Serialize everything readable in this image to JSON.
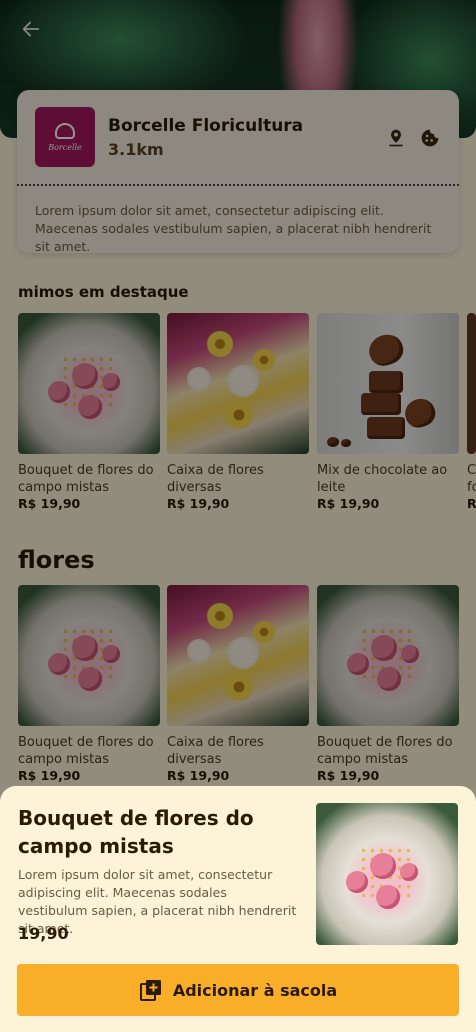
{
  "store": {
    "name": "Borcelle Floricultura",
    "distance": "3.1km",
    "logo_text": "Borcelle",
    "description": "Lorem ipsum dolor sit amet, consectetur adipiscing elit. Maecenas sodales vestibulum sapien, a placerat nibh hendrerit sit amet."
  },
  "sections": {
    "featured_title": "mimos em destaque",
    "flowers_title": "flores"
  },
  "featured": [
    {
      "name": "Bouquet de flores do campo mistas",
      "price": "R$ 19,90",
      "image": "bouquet"
    },
    {
      "name": "Caixa de flores diversas",
      "price": "R$ 19,90",
      "image": "flower-box"
    },
    {
      "name": "Mix de chocolate ao leite",
      "price": "R$ 19,90",
      "image": "chocolate"
    },
    {
      "name": "C fo",
      "price": "R",
      "image": "partial"
    }
  ],
  "flowers": [
    {
      "name": "Bouquet de flores do campo mistas",
      "price": "R$ 19,90",
      "image": "bouquet"
    },
    {
      "name": "Caixa de flores diversas",
      "price": "R$ 19,90",
      "image": "flower-box"
    },
    {
      "name": "Bouquet de flores do campo mistas",
      "price": "R$ 19,90",
      "image": "bouquet"
    }
  ],
  "detail": {
    "title": "Bouquet de flores do campo mistas",
    "description": "Lorem ipsum dolor sit amet, consectetur adipiscing elit. Maecenas sodales vestibulum sapien, a placerat nibh hendrerit sit amet.",
    "price": "19,90",
    "add_button_label": "Adicionar à sacola"
  },
  "icons": {
    "back": "arrow-left-icon",
    "location": "location-pin-icon",
    "cookie": "cookie-icon",
    "add_to_bag": "add-box-icon"
  },
  "colors": {
    "background": "#fbf2d8",
    "sheet": "#fdf3d8",
    "accent": "#f9ae2a",
    "logo": "#a3175f"
  }
}
